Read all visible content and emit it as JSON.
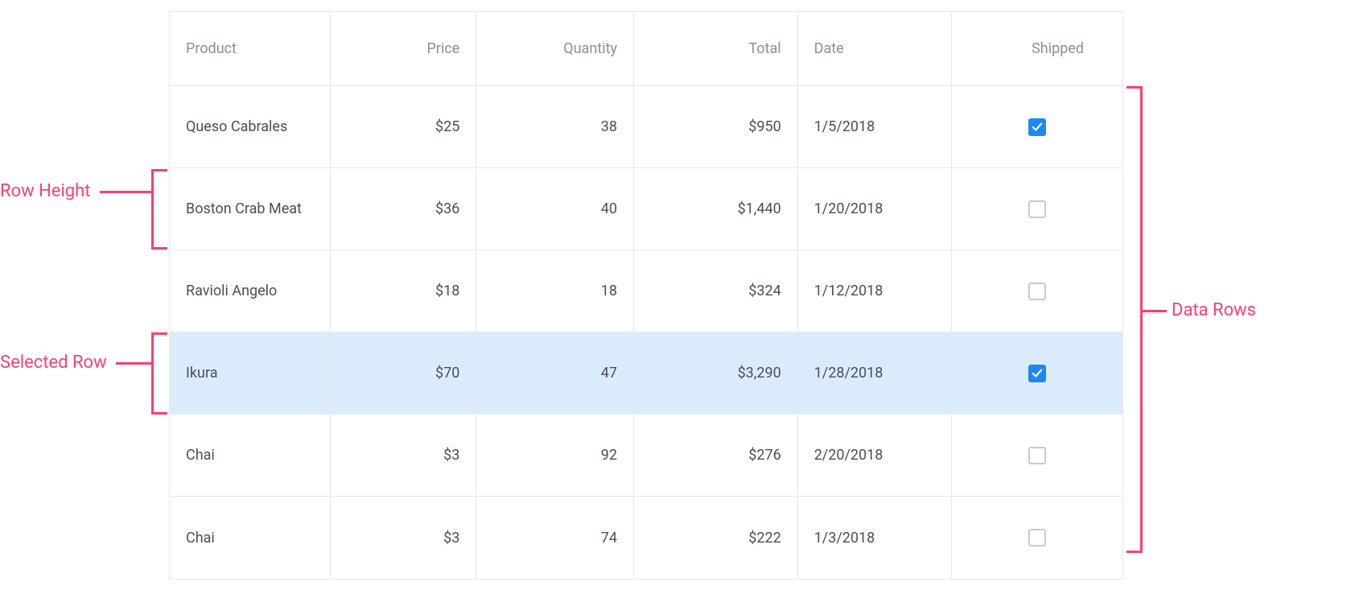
{
  "annotations": {
    "row_height_label": "Row Height",
    "selected_row_label": "Selected Row",
    "data_rows_label": "Data Rows"
  },
  "table": {
    "headers": {
      "product": "Product",
      "price": "Price",
      "quantity": "Quantity",
      "total": "Total",
      "date": "Date",
      "shipped": "Shipped"
    },
    "rows": [
      {
        "product": "Queso Cabrales",
        "price": "$25",
        "quantity": "38",
        "total": "$950",
        "date": "1/5/2018",
        "shipped": true,
        "selected": false
      },
      {
        "product": "Boston Crab Meat",
        "price": "$36",
        "quantity": "40",
        "total": "$1,440",
        "date": "1/20/2018",
        "shipped": false,
        "selected": false
      },
      {
        "product": "Ravioli Angelo",
        "price": "$18",
        "quantity": "18",
        "total": "$324",
        "date": "1/12/2018",
        "shipped": false,
        "selected": false
      },
      {
        "product": "Ikura",
        "price": "$70",
        "quantity": "47",
        "total": "$3,290",
        "date": "1/28/2018",
        "shipped": true,
        "selected": true
      },
      {
        "product": "Chai",
        "price": "$3",
        "quantity": "92",
        "total": "$276",
        "date": "2/20/2018",
        "shipped": false,
        "selected": false
      },
      {
        "product": "Chai",
        "price": "$3",
        "quantity": "74",
        "total": "$222",
        "date": "1/3/2018",
        "shipped": false,
        "selected": false
      }
    ]
  }
}
